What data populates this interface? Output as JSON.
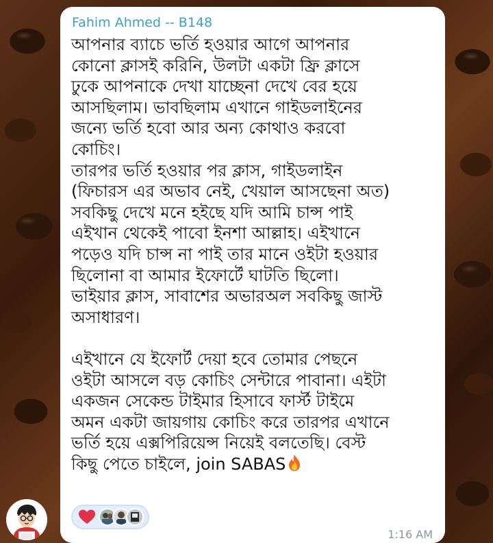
{
  "message": {
    "sender": "Fahim Ahmed -- B148",
    "text": "আপনার ব্যাচে ভর্তি হওয়ার আগে আপনার\nকোনো ক্লাসই করিনি, উলটা একটা ফ্রি ক্লাসে\nঢুকে আপনাকে দেখা যাচ্ছেনা দেখে বের হয়ে\nআসছিলাম। ভাবছিলাম এখানে গাইডলাইনের\nজন্যে ভর্তি হবো আর অন্য কোথাও করবো\nকোচিং।\nতারপর ভর্তি হওয়ার পর ক্লাস, গাইডলাইন\n(ফিচারস এর অভাব নেই, খেয়াল আসছেনা অত)\nসবকিছু দেখে মনে হইছে যদি আমি চান্স পাই\nএইখান থেকেই পাবো ইনশা আল্লাহ। এইখানে\nপড়েও যদি চান্স না পাই তার মানে ওইটা হওয়ার\nছিলোনা বা আমার ইফোর্টে ঘাটতি ছিলো।\nভাইয়ার ক্লাস, সাবাশের অভারঅল সবকিছু জাস্ট\nঅসাধারণ।\n\nএইখানে যে ইফোর্ট দেয়া হবে তোমার পেছনে\nওইটা আসলে বড় কোচিং সেন্টারে পাবানা। এইটা\nএকজন সেকেন্ড টাইমার হিসাবে ফার্স্ট টাইমে\nঅমন একটা জায়গায় কোচিং করে তারপর এখানে\nভর্তি হয়ে এক্সপিরিয়েন্স নিয়েই বলতেছি। বেস্ট\nকিছু পেতে চাইলে, join SABAS",
    "timestamp": "1:16 AM"
  },
  "reactions": {
    "emoji_icon": "heart-icon",
    "reactor_count_shown": 3
  },
  "colors": {
    "sender_name": "#3aa2c9",
    "bubble": "#ffffff",
    "timestamp": "#8c959e",
    "reaction_bg": "#e3eefb",
    "heart": "#e0304a"
  }
}
